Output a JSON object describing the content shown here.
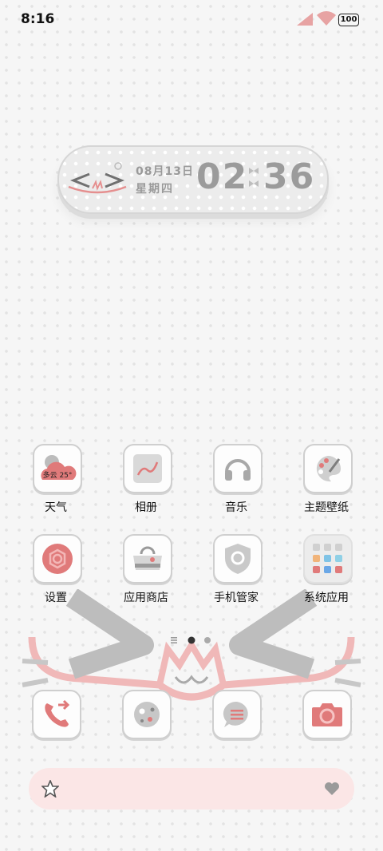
{
  "status_bar": {
    "time": "8:16",
    "battery": "100"
  },
  "widget": {
    "date": "08月13日",
    "weekday": "星期四",
    "hour": "02",
    "minute": "36"
  },
  "weather": {
    "text": "多云 25°"
  },
  "apps_row1": [
    {
      "label": "天气",
      "icon": "weather-icon"
    },
    {
      "label": "相册",
      "icon": "gallery-icon"
    },
    {
      "label": "音乐",
      "icon": "headphones-icon"
    },
    {
      "label": "主题壁纸",
      "icon": "palette-icon"
    }
  ],
  "apps_row2": [
    {
      "label": "设置",
      "icon": "settings-icon"
    },
    {
      "label": "应用商店",
      "icon": "store-bag-icon"
    },
    {
      "label": "手机管家",
      "icon": "shield-icon"
    },
    {
      "label": "系统应用",
      "icon": "folder-icon"
    }
  ],
  "dock": [
    {
      "icon": "phone-icon"
    },
    {
      "icon": "browser-icon"
    },
    {
      "icon": "messages-icon"
    },
    {
      "icon": "camera-icon"
    }
  ],
  "colors": {
    "accent": "#e07a7a",
    "gray": "#9b9b9b",
    "pink_bg": "#fbe6e6"
  }
}
